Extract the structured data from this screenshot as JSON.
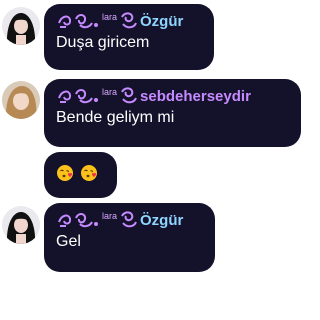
{
  "messages": [
    {
      "author_small": "lara",
      "author_name": "Özgür",
      "text": "Duşa giricem",
      "avatar": "girl-avatar"
    },
    {
      "author_small": "lara",
      "author_name": "sebdeherseydir",
      "text": "Bende geliym mi",
      "avatar": "blonde-avatar"
    },
    {
      "emojis": [
        "kissing-face-with-heart-icon",
        "kissing-face-with-heart-icon"
      ]
    },
    {
      "author_small": "lara",
      "author_name": "Özgür",
      "text": "Gel",
      "avatar": "girl-avatar"
    }
  ],
  "colors": {
    "bubble": "#14112a",
    "ozgur_name": "#8fd6ff",
    "sebde_name": "#c58aff",
    "small_name": "#d9a8ff",
    "text": "#ffffff"
  }
}
